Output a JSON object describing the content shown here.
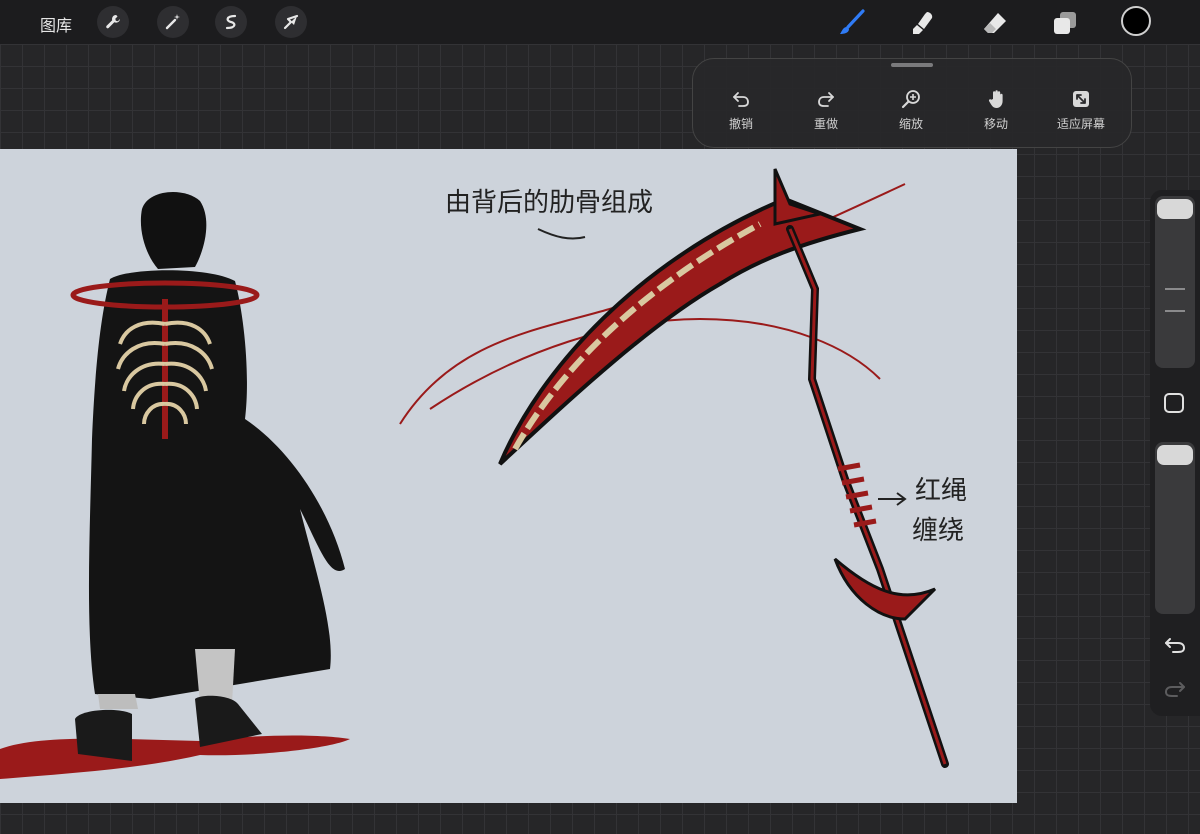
{
  "topbar": {
    "gallery_label": "图库",
    "left_tools": [
      "wrench-icon",
      "magic-wand-icon",
      "selection-s-icon",
      "move-arrow-icon"
    ],
    "right_tools": [
      "brush-icon",
      "smudge-icon",
      "eraser-icon",
      "layers-icon"
    ],
    "active_tool": "brush-icon",
    "accent_color": "#2f7bf6",
    "current_color": "#000000"
  },
  "quick_panel": {
    "buttons": [
      {
        "label": "撤销",
        "icon": "undo-icon"
      },
      {
        "label": "重做",
        "icon": "redo-icon"
      },
      {
        "label": "缩放",
        "icon": "zoom-icon"
      },
      {
        "label": "移动",
        "icon": "hand-move-icon"
      },
      {
        "label": "适应屏幕",
        "icon": "fit-screen-icon"
      }
    ]
  },
  "canvas": {
    "background": "#cdd3db",
    "annotations": {
      "rib_note": "由背后的肋骨组成",
      "rope_line1": "红绳",
      "rope_line2": "缠绕"
    },
    "colors": {
      "ink": "#111111",
      "blood": "#9a1a1a",
      "bone": "#d9c8a0"
    }
  },
  "sidebar": {
    "icons": [
      "undo-icon",
      "redo-icon",
      "modify-square-icon"
    ]
  }
}
